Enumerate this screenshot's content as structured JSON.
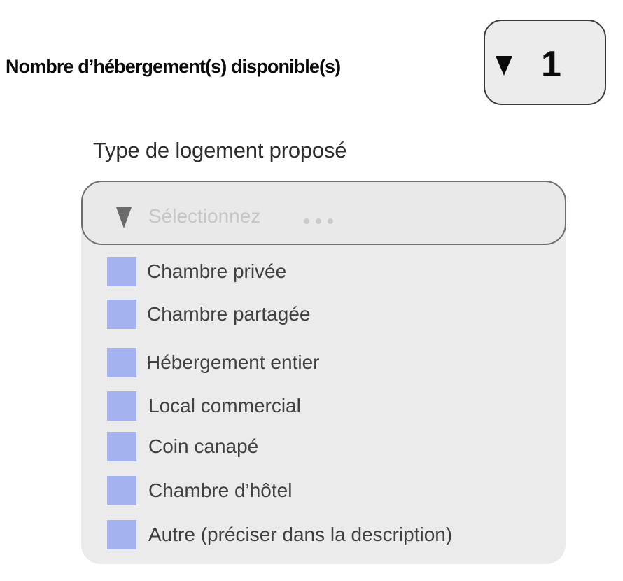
{
  "accommodation_count": {
    "label": "Nombre d’hébergement(s) disponible(s)",
    "value": "1",
    "arrow_icon": "triangle-down-icon"
  },
  "lodging_type": {
    "label": "Type de logement proposé",
    "placeholder": "Sélectionnez",
    "more_icon": "ellipsis-icon",
    "arrow_icon": "triangle-down-icon",
    "checkbox_color": "#a4b2ef",
    "options": [
      {
        "label": "Chambre privée",
        "checked": false
      },
      {
        "label": "Chambre partagée",
        "checked": false
      },
      {
        "label": "Hébergement entier",
        "checked": false
      },
      {
        "label": "Local commercial",
        "checked": false
      },
      {
        "label": "Coin canapé",
        "checked": false
      },
      {
        "label": "Chambre d’hôtel",
        "checked": false
      },
      {
        "label": "Autre (préciser dans la description)",
        "checked": false
      }
    ]
  }
}
